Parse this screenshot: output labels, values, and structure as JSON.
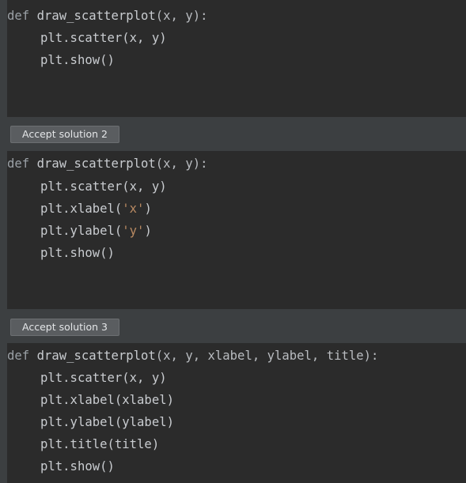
{
  "solutions": [
    {
      "lines": [
        {
          "kw": "def",
          "name": "draw_scatterplot",
          "args": "(x, y):"
        },
        {
          "code": "plt.scatter(x, y)"
        },
        {
          "code": "plt.show()"
        }
      ]
    },
    {
      "accept_label": "Accept solution 2",
      "lines": [
        {
          "kw": "def",
          "name": "draw_scatterplot",
          "args": "(x, y):"
        },
        {
          "code": "plt.scatter(x, y)"
        },
        {
          "pre": "plt.xlabel(",
          "str": "'x'",
          "post": ")"
        },
        {
          "pre": "plt.ylabel(",
          "str": "'y'",
          "post": ")"
        },
        {
          "code": "plt.show()"
        }
      ]
    },
    {
      "accept_label": "Accept solution 3",
      "lines": [
        {
          "kw": "def",
          "name": "draw_scatterplot",
          "args": "(x, y, xlabel, ylabel, title):"
        },
        {
          "code": "plt.scatter(x, y)"
        },
        {
          "code": "plt.xlabel(xlabel)"
        },
        {
          "code": "plt.ylabel(ylabel)"
        },
        {
          "code": "plt.title(title)"
        },
        {
          "code": "plt.show()"
        }
      ]
    }
  ]
}
